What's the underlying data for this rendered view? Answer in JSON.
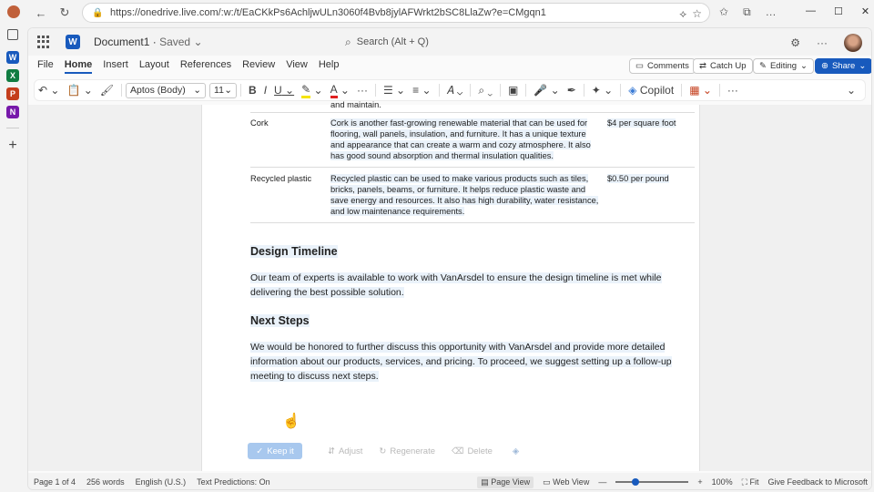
{
  "browser": {
    "url": "https://onedrive.live.com/:w:/t/EaCKkPs6AchljwULn3060f4Bvb8jylAFWrkt2bSC8LlaZw?e=CMgqn1",
    "minimize": "—",
    "maximize": "☐",
    "close": "✕"
  },
  "rail": {
    "icons": [
      {
        "name": "word-app-icon",
        "glyph": "W",
        "color": "#185abd"
      },
      {
        "name": "excel-app-icon",
        "glyph": "X",
        "color": "#107c41"
      },
      {
        "name": "powerpoint-app-icon",
        "glyph": "P",
        "color": "#c43e1c"
      },
      {
        "name": "onenote-app-icon",
        "glyph": "N",
        "color": "#7719aa"
      }
    ]
  },
  "app": {
    "doc_name": "Document1",
    "doc_status": "Saved",
    "search_placeholder": "Search (Alt + Q)"
  },
  "menu": {
    "tabs": [
      "File",
      "Home",
      "Insert",
      "Layout",
      "References",
      "Review",
      "View",
      "Help"
    ],
    "active_tab": "Home",
    "comments_label": "Comments",
    "catchup_label": "Catch Up",
    "editing_label": "Editing",
    "share_label": "Share"
  },
  "ribbon": {
    "font_name": "Aptos (Body)",
    "font_size": "11",
    "bold": "B",
    "italic": "I",
    "underline": "U",
    "copilot_label": "Copilot",
    "highlight_color": "#f5e400",
    "font_color": "#e02020"
  },
  "table": {
    "prev_tail": "and maintain.",
    "rows": [
      {
        "material": "Cork",
        "description_lines": [
          "Cork is another fast-growing renewable material that can be used for",
          "flooring, wall panels, insulation, and furniture. It has a unique texture",
          "and appearance that can create a warm and cozy atmosphere. It also",
          "has good sound absorption and thermal insulation qualities."
        ],
        "price": "$4 per square foot"
      },
      {
        "material": "Recycled plastic",
        "description_lines": [
          "Recycled plastic can be used to make various products such as tiles,",
          "bricks, panels, beams, or furniture. It helps reduce plastic waste and",
          "save energy and resources. It also has high durability, water resistance,",
          "and low maintenance requirements."
        ],
        "price": "$0.50 per pound"
      }
    ]
  },
  "sections": {
    "timeline_heading": "Design Timeline",
    "timeline_lines": [
      "Our team of experts is available to work with VanArsdel to ensure the design timeline is met while",
      "delivering the best possible solution."
    ],
    "next_heading": "Next Steps",
    "next_lines": [
      "We would be honored to further discuss this opportunity with VanArsdel and provide more detailed",
      "information about our products, services, and pricing. To proceed, we suggest setting up a follow-up",
      "meeting to discuss next steps."
    ]
  },
  "copilot_actions": {
    "keep": "Keep it",
    "adjust": "Adjust",
    "regenerate": "Regenerate",
    "delete": "Delete"
  },
  "status": {
    "page": "Page 1 of 4",
    "words": "256 words",
    "language": "English (U.S.)",
    "predictions": "Text Predictions: On",
    "page_view": "Page View",
    "web_view": "Web View",
    "zoom": "100%",
    "fit": "Fit",
    "feedback": "Give Feedback to Microsoft"
  }
}
